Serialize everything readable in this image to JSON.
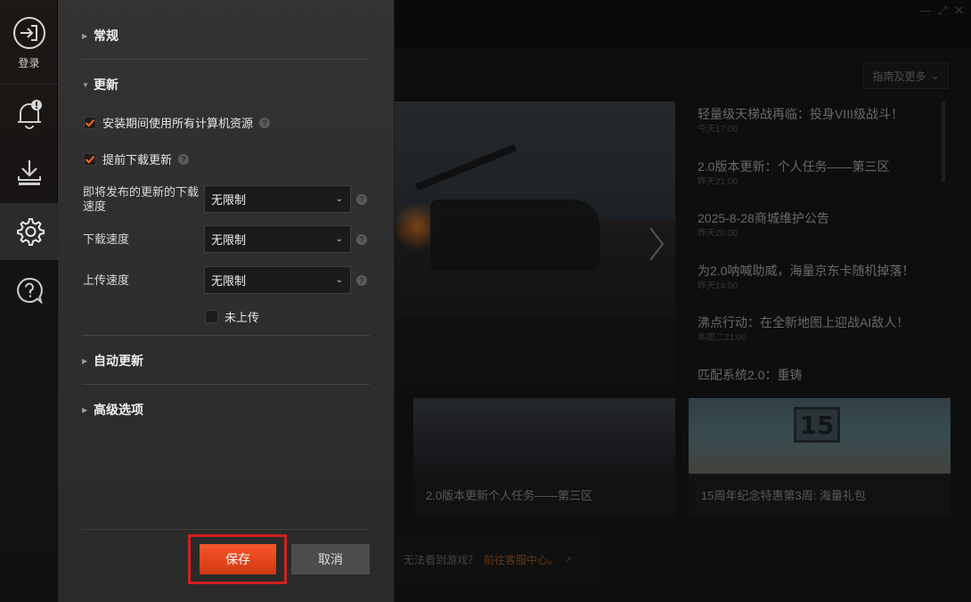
{
  "sidebar": {
    "login_label": "登录",
    "icons": [
      "login-icon",
      "bell-icon",
      "download-icon",
      "gear-icon",
      "help-icon"
    ]
  },
  "settings": {
    "sections": {
      "general": "常规",
      "update": "更新",
      "auto_update": "自动更新",
      "advanced": "高级选项"
    },
    "update": {
      "use_all_resources": {
        "label": "安装期间使用所有计算机资源",
        "checked": true
      },
      "predownload": {
        "label": "提前下载更新",
        "checked": true
      },
      "upcoming_speed": {
        "label": "即将发布的更新的下载速度",
        "value": "无限制"
      },
      "download_speed": {
        "label": "下载速度",
        "value": "无限制"
      },
      "upload_speed": {
        "label": "上传速度",
        "value": "无限制"
      },
      "not_uploaded": {
        "label": "未上传",
        "checked": false
      }
    },
    "buttons": {
      "save": "保存",
      "cancel": "取消"
    }
  },
  "background": {
    "guide_button": "指南及更多",
    "news": [
      {
        "title": "轻量级天梯战再临：投身VIII级战斗！",
        "time": "今天17:00"
      },
      {
        "title": "2.0版本更新：个人任务——第三区",
        "time": "昨天21:00"
      },
      {
        "title": "2025-8-28商城维护公告",
        "time": "昨天20:00"
      },
      {
        "title": "为2.0呐喊助威，海量京东卡随机掉落！",
        "time": "昨天14:00"
      },
      {
        "title": "沸点行动：在全新地图上迎战AI敌人！",
        "time": "本周二21:00"
      },
      {
        "title": "匹配系统2.0：重铸",
        "time": ""
      }
    ],
    "cards": [
      {
        "caption": "2.0版本更新个人任务——第三区"
      },
      {
        "caption": "15周年纪念特惠第3周: 海量礼包",
        "badge": "15"
      }
    ],
    "help": {
      "question": "无法看到游戏？",
      "link": "前往客服中心。"
    }
  },
  "colors": {
    "accent": "#e4451a",
    "highlight_outline": "#d21f1f",
    "checkbox_check": "#ff6a1a"
  }
}
